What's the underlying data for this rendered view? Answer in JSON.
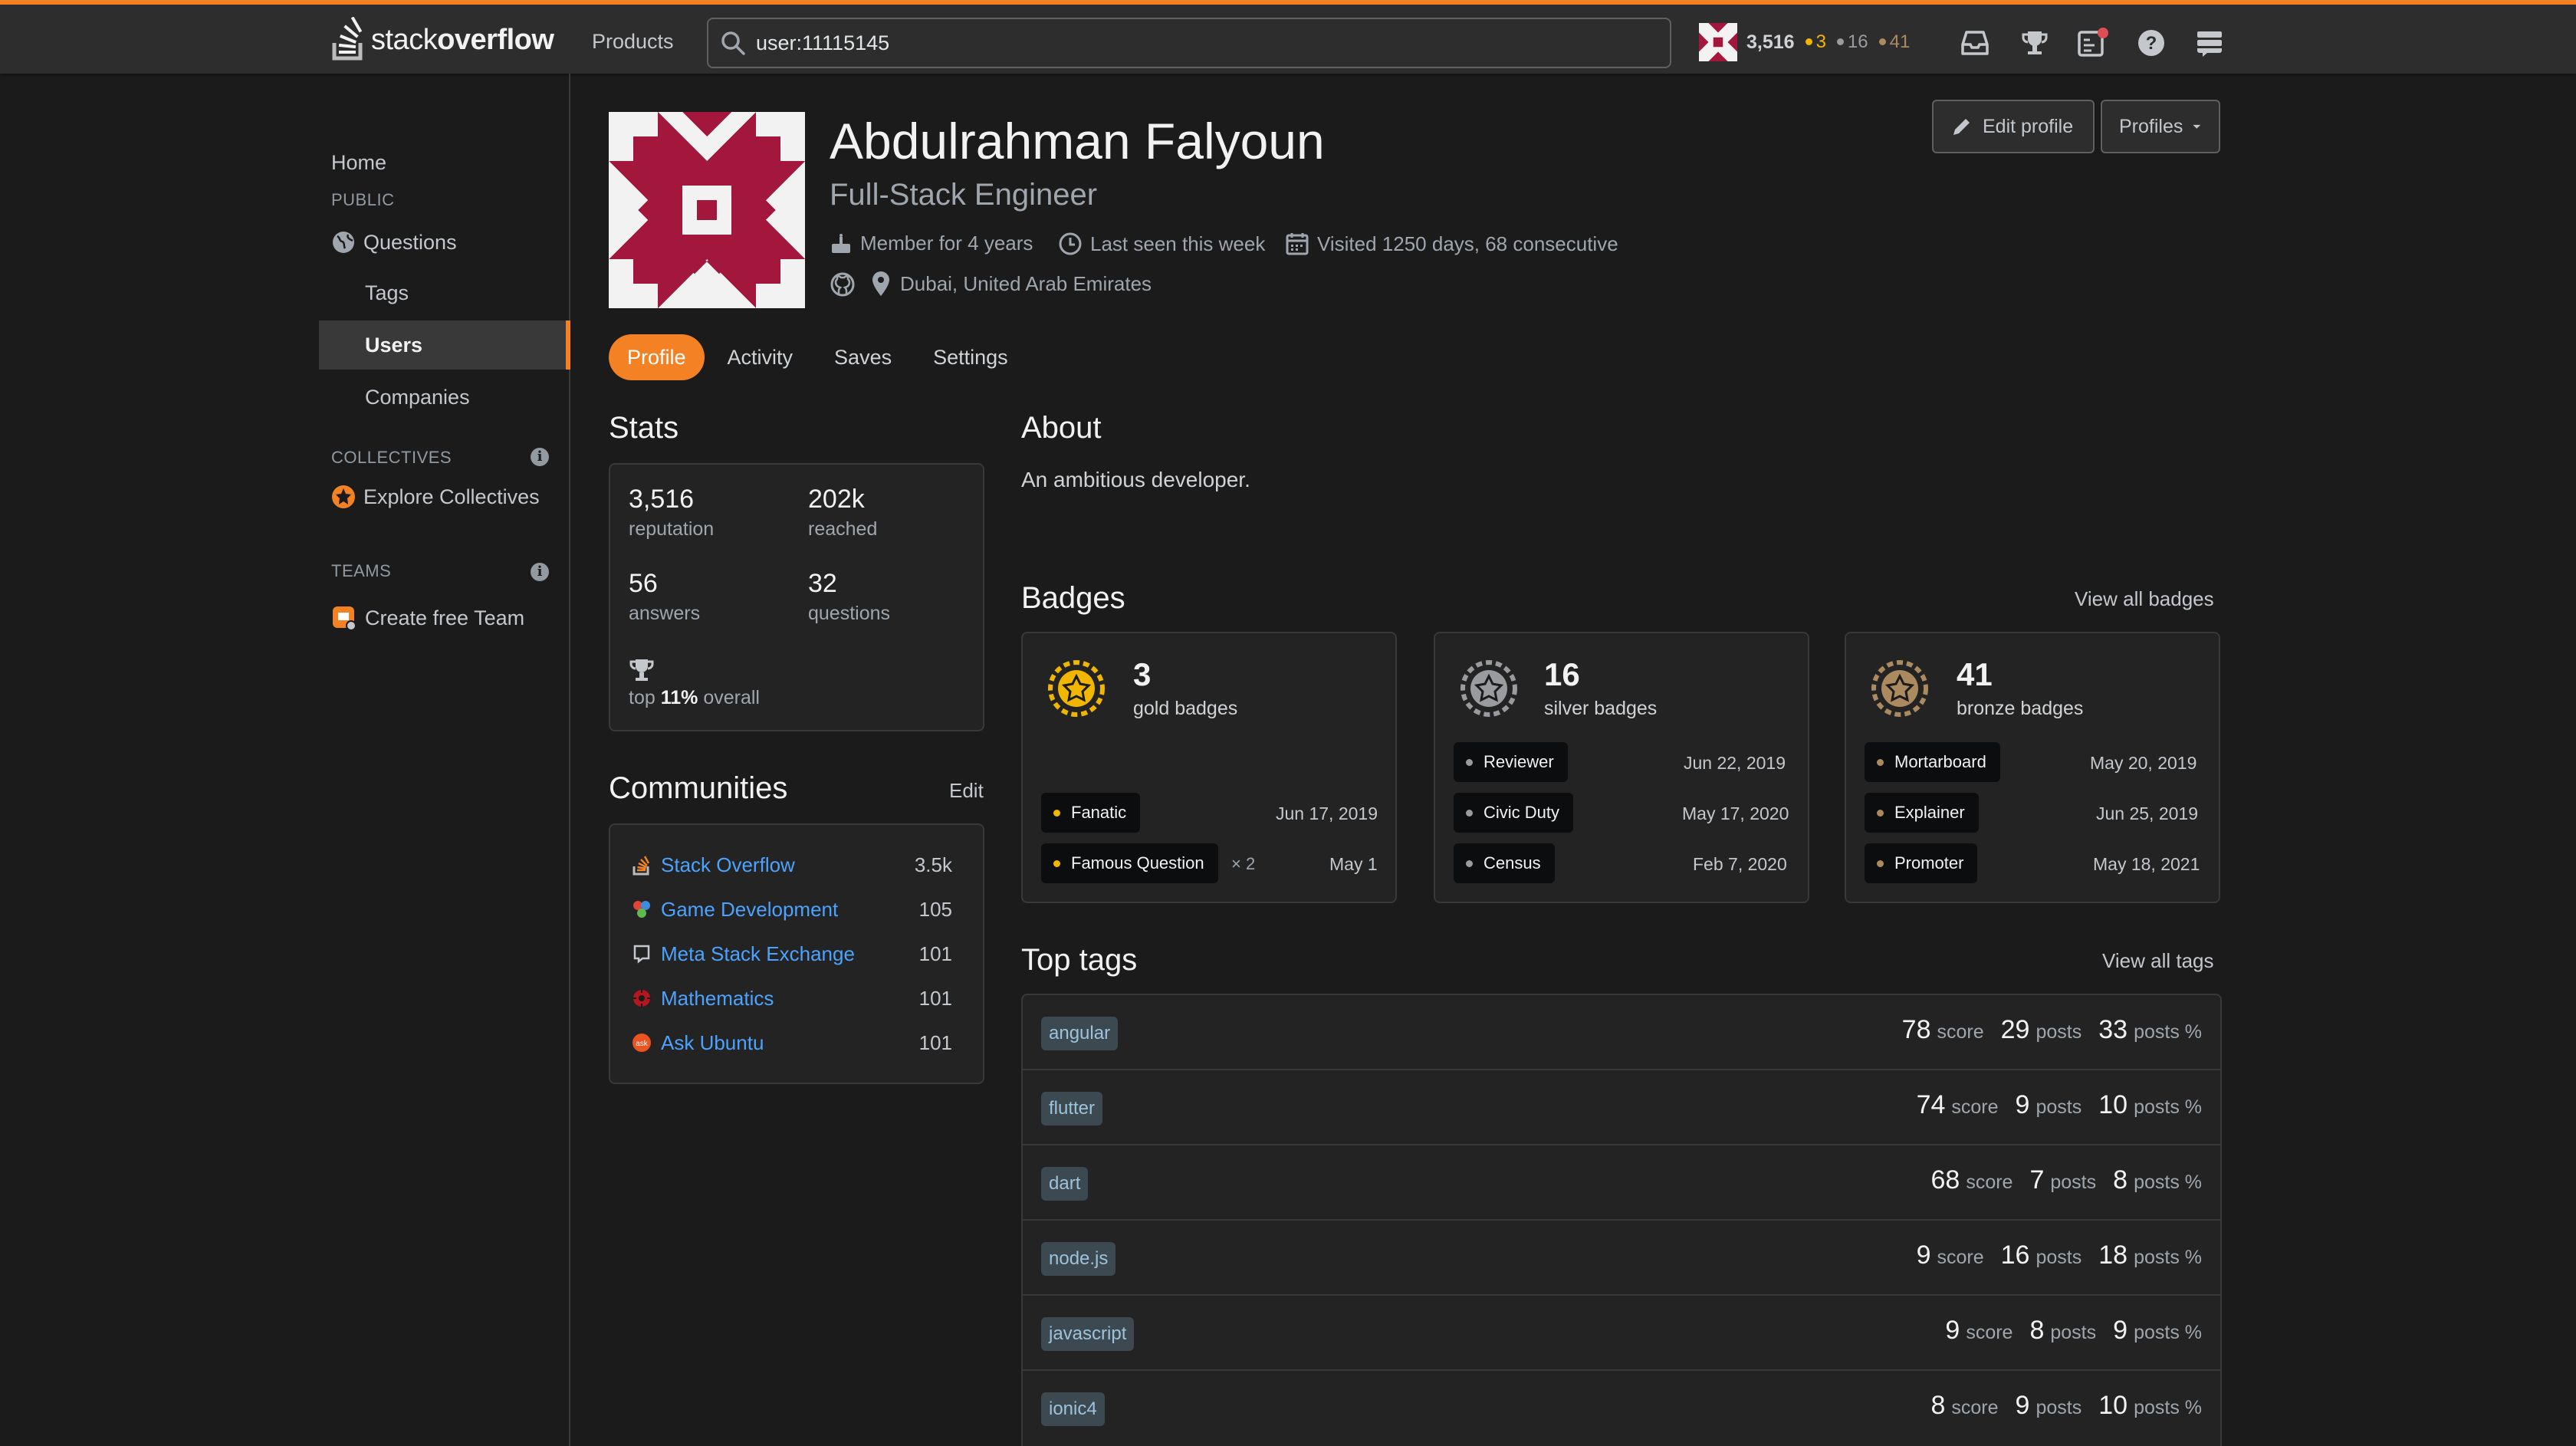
{
  "topbar": {
    "logo_light": "stack",
    "logo_bold": "overflow",
    "products": "Products",
    "search_value": "user:11115145",
    "reputation": "3,516",
    "gold": "3",
    "silver": "16",
    "bronze": "41",
    "accent_color": "#f48225"
  },
  "sidebar": {
    "home": "Home",
    "public_head": "PUBLIC",
    "questions": "Questions",
    "tags": "Tags",
    "users": "Users",
    "companies": "Companies",
    "collectives_head": "COLLECTIVES",
    "explore_collectives": "Explore Collectives",
    "teams_head": "TEAMS",
    "create_team": "Create free Team"
  },
  "profile": {
    "name": "Abdulrahman Falyoun",
    "title": "Full-Stack Engineer",
    "member_for": "Member for 4 years",
    "last_seen": "Last seen this week",
    "visited": "Visited 1250 days, 68 consecutive",
    "location": "Dubai, United Arab Emirates",
    "edit_profile": "Edit profile",
    "profiles": "Profiles"
  },
  "tabs": [
    "Profile",
    "Activity",
    "Saves",
    "Settings"
  ],
  "stats": {
    "heading": "Stats",
    "reputation": "3,516",
    "reputation_label": "reputation",
    "reached": "202k",
    "reached_label": "reached",
    "answers": "56",
    "answers_label": "answers",
    "questions": "32",
    "questions_label": "questions",
    "top_prefix": "top ",
    "top_value": "11%",
    "top_suffix": " overall"
  },
  "communities": {
    "heading": "Communities",
    "edit": "Edit",
    "items": [
      {
        "name": "Stack Overflow",
        "value": "3.5k"
      },
      {
        "name": "Game Development",
        "value": "105"
      },
      {
        "name": "Meta Stack Exchange",
        "value": "101"
      },
      {
        "name": "Mathematics",
        "value": "101"
      },
      {
        "name": "Ask Ubuntu",
        "value": "101"
      }
    ]
  },
  "about": {
    "heading": "About",
    "text": "An ambitious developer."
  },
  "badges": {
    "heading": "Badges",
    "view_all": "View all badges",
    "gold": {
      "count": "3",
      "label": "gold badges",
      "color": "#f1b600",
      "items": [
        {
          "name": "Fanatic",
          "date": "Jun 17, 2019",
          "times": ""
        },
        {
          "name": "Famous Question",
          "date": "May 1",
          "times": "× 2"
        }
      ]
    },
    "silver": {
      "count": "16",
      "label": "silver badges",
      "color": "#9a9b9e",
      "items": [
        {
          "name": "Reviewer",
          "date": "Jun 22, 2019"
        },
        {
          "name": "Civic Duty",
          "date": "May 17, 2020"
        },
        {
          "name": "Census",
          "date": "Feb 7, 2020"
        }
      ]
    },
    "bronze": {
      "count": "41",
      "label": "bronze badges",
      "color": "#ab8a5f",
      "items": [
        {
          "name": "Mortarboard",
          "date": "May 20, 2019"
        },
        {
          "name": "Explainer",
          "date": "Jun 25, 2019"
        },
        {
          "name": "Promoter",
          "date": "May 18, 2021"
        }
      ]
    }
  },
  "top_tags": {
    "heading": "Top tags",
    "view_all": "View all tags",
    "score_unit": "score",
    "posts_unit": "posts",
    "pct_unit": "posts %",
    "items": [
      {
        "tag": "angular",
        "score": "78",
        "posts": "29",
        "pct": "33"
      },
      {
        "tag": "flutter",
        "score": "74",
        "posts": "9",
        "pct": "10"
      },
      {
        "tag": "dart",
        "score": "68",
        "posts": "7",
        "pct": "8"
      },
      {
        "tag": "node.js",
        "score": "9",
        "posts": "16",
        "pct": "18"
      },
      {
        "tag": "javascript",
        "score": "9",
        "posts": "8",
        "pct": "9"
      },
      {
        "tag": "ionic4",
        "score": "8",
        "posts": "9",
        "pct": "10"
      }
    ]
  }
}
